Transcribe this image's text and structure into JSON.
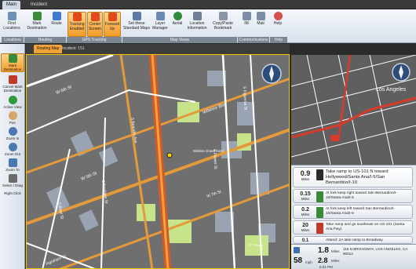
{
  "tabs": [
    "Main",
    "Incident"
  ],
  "ribbon": {
    "buttons": [
      {
        "label": "Find Locations",
        "icon": "search-icon",
        "color": "#6f8fb8",
        "highlight": false
      },
      {
        "label": "Mark Destination",
        "icon": "flag-icon",
        "color": "#3a8a3a",
        "highlight": false
      },
      {
        "label": "Route",
        "icon": "route-icon",
        "color": "#3d7bd1",
        "highlight": false
      },
      {
        "label": "Tracking Enabled",
        "icon": "tracking-icon",
        "color": "#e24a1e",
        "highlight": true
      },
      {
        "label": "Center Screen",
        "icon": "center-icon",
        "color": "#e24a1e",
        "highlight": true
      },
      {
        "label": "Forward Up",
        "icon": "forward-up-icon",
        "color": "#e24a1e",
        "highlight": true
      },
      {
        "label": "Set these Standard Maps",
        "icon": "maps-icon",
        "color": "#5c7aa6",
        "highlight": false
      },
      {
        "label": "Layer Manager",
        "icon": "layers-icon",
        "color": "#6b89b3",
        "highlight": false
      },
      {
        "label": "Aerial",
        "icon": "globe-icon",
        "color": "#2f8a3c",
        "highlight": false
      },
      {
        "label": "Location Information",
        "icon": "info-icon",
        "color": "#6f7f96",
        "highlight": false
      },
      {
        "label": "Copy/Paste Bookmark",
        "icon": "bookmark-icon",
        "color": "#8a96a8",
        "highlight": false
      },
      {
        "label": "IM",
        "icon": "chat-icon",
        "color": "#7d8ea6",
        "highlight": false
      },
      {
        "label": "Mail",
        "icon": "mail-icon",
        "color": "#7d8ea6",
        "highlight": false
      },
      {
        "label": "Help",
        "icon": "help-icon",
        "color": "#d65050",
        "highlight": false
      }
    ],
    "groups": [
      "Locations",
      "Routing",
      "GPS Tracking",
      "Map Views",
      "Communications",
      "Help"
    ]
  },
  "left_tools": [
    {
      "label": "Mark Destination",
      "icon": "flag-icon",
      "color": "#3a8a3a",
      "highlight": true
    },
    {
      "label": "Cancel Mark Destination",
      "icon": "cancel-flag-icon",
      "color": "#c0392b",
      "highlight": false
    },
    {
      "label": "Active View",
      "icon": "check-icon",
      "color": "#2e9a3a",
      "highlight": false
    },
    {
      "label": "Pan",
      "icon": "hand-icon",
      "color": "#d8a56b",
      "highlight": false
    },
    {
      "label": "Zoom In",
      "icon": "zoom-in-icon",
      "color": "#4a78b0",
      "highlight": false
    },
    {
      "label": "Zoom Out",
      "icon": "zoom-out-icon",
      "color": "#4a78b0",
      "highlight": false
    },
    {
      "label": "Zoom To",
      "icon": "zoom-to-icon",
      "color": "#4a78b0",
      "highlight": false
    },
    {
      "label": "Select / Drag",
      "icon": "select-icon",
      "color": "#6a6a6a",
      "highlight": false
    },
    {
      "label": "Right Click",
      "icon": "",
      "color": "",
      "highlight": false
    }
  ],
  "subtabs": [
    "Routing Map",
    "Incident: 151"
  ],
  "map": {
    "streets": [
      "W 6th St",
      "W 5th St",
      "Wilshire Blvd",
      "S Flower St",
      "S Figueroa St",
      "S Beaudry Ave",
      "S Bixel St",
      "S Boylston St",
      "Ingraham St",
      "W 7th St"
    ],
    "places": [
      "Wilshire Grand Hotel",
      "FTT Street"
    ],
    "minimap_label": "Los Angeles"
  },
  "directions": {
    "current": {
      "distance": "0.9",
      "unit": "Miles",
      "text": "Take ramp to US-101 N toward Hollywood/Santa Ana/I-5/San Bernardino/I-10"
    },
    "steps": [
      {
        "distance": "0.15",
        "unit": "Miles",
        "text": "At fork keep right toward San Bernardino/I-10/Santa Ana/I-5"
      },
      {
        "distance": "0.2",
        "unit": "Miles",
        "text": "At fork keep left toward San Bernardino/I-10/Santa Ana/I-5"
      },
      {
        "distance": "20",
        "unit": "Miles",
        "text": "Take ramp and go southeast on US-101 (Santa Ana Fwy)"
      },
      {
        "distance": "0.1",
        "unit": "Miles",
        "text": "Attend: 2A take ramp to Broadway"
      }
    ]
  },
  "status": {
    "speed": "58",
    "speed_unit": "mph",
    "dist1": "1.8",
    "dist1_unit": "Miles",
    "dist2": "2.8",
    "dist2_unit": "Miles",
    "time": "6:01 PM",
    "address": "115 N BROADWAY, LOS ANGELES, CA 90012"
  },
  "colors": {
    "accent": "#f39a28",
    "route": "#f3a23a",
    "highway": "#d05a2a",
    "map_bg": "#6f6f6f",
    "building": "#9aa3b2",
    "park": "#c7e48a"
  }
}
